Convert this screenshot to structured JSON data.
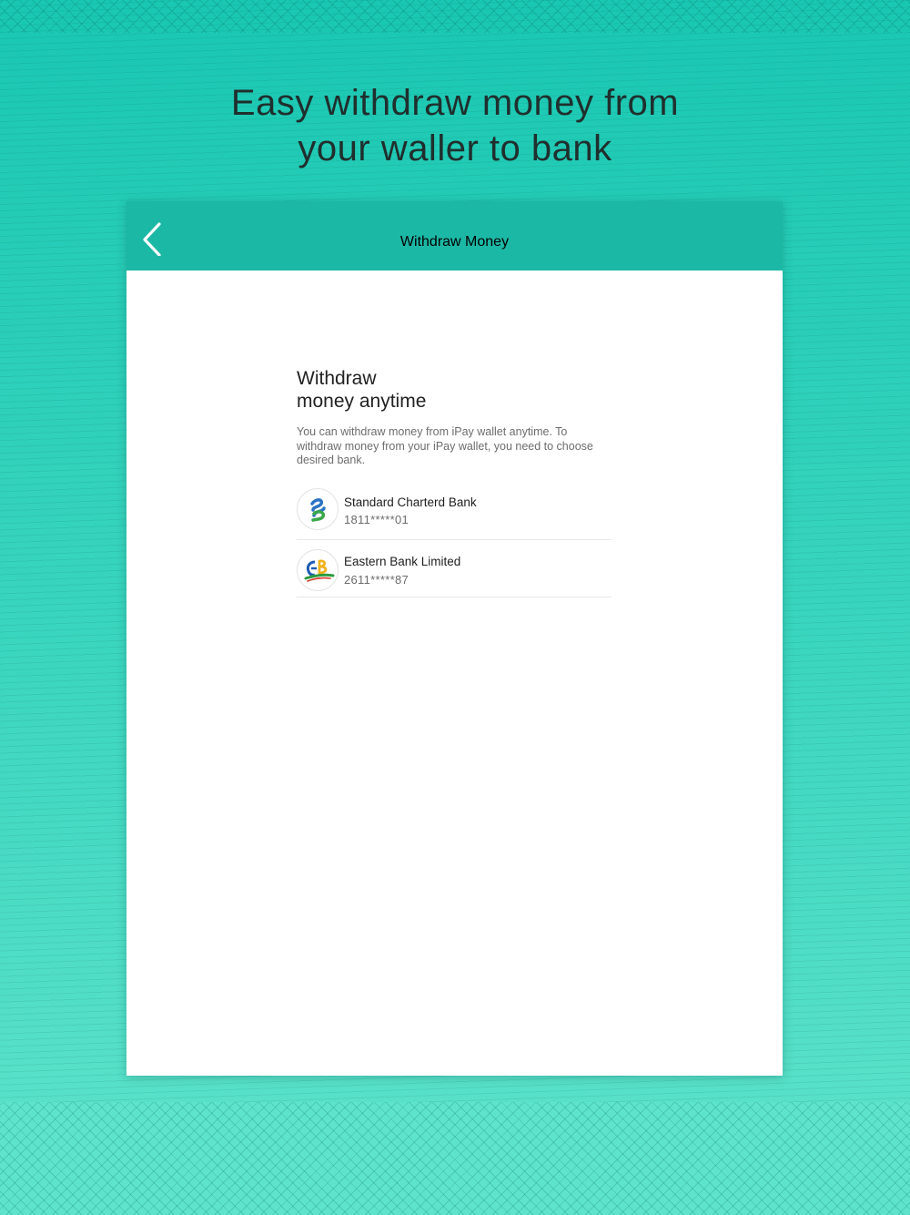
{
  "headline": {
    "line1": "Easy withdraw money from",
    "line2": "your waller to bank"
  },
  "nav": {
    "title": "Withdraw Money",
    "back_icon": "chevron-left-icon"
  },
  "content": {
    "title_line1": "Withdraw",
    "title_line2": "money anytime",
    "description": "You can withdraw money from iPay wallet anytime. To withdraw money from your iPay wallet, you need to choose desired bank."
  },
  "banks": [
    {
      "name": "Standard Charterd Bank",
      "account": "1811*****01",
      "logo": "standard-chartered-logo"
    },
    {
      "name": "Eastern Bank Limited",
      "account": "2611*****87",
      "logo": "eastern-bank-logo"
    }
  ],
  "colors": {
    "nav_bar": "#1bb8a5",
    "background": "#2fd0b9",
    "card": "#ffffff"
  }
}
